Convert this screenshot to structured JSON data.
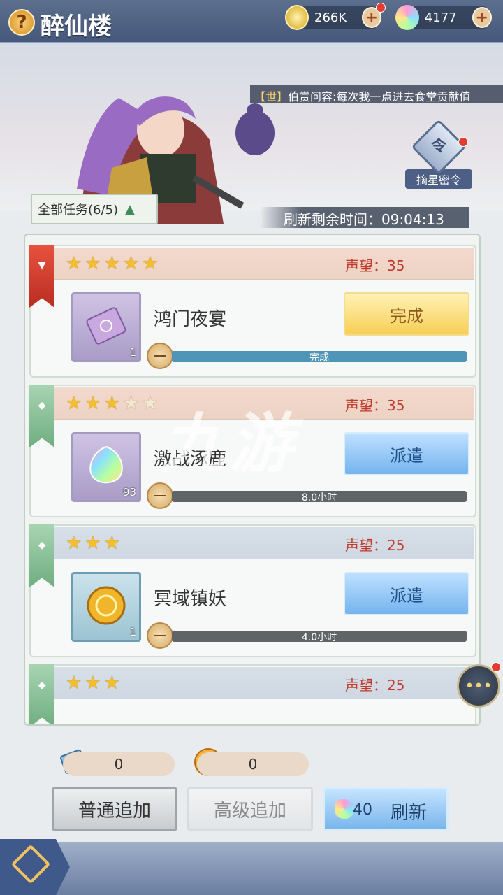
{
  "header": {
    "title": "醉仙楼",
    "help_icon": "?",
    "coins": "266K",
    "gems": "4177",
    "plus": "+"
  },
  "banner": {
    "ticker_tag": "【世】",
    "ticker_text": "伯赏问容:每次我一点进去食堂贡献值",
    "seal_glyph": "令",
    "seal_label": "摘星密令"
  },
  "filter": {
    "all_tasks": "全部任务(6/5)"
  },
  "refresh_timer": "刷新剩余时间：09:04:13",
  "tasks": [
    {
      "stars": 5,
      "max_stars": 5,
      "prestige": "声望：35",
      "name": "鸿门夜宴",
      "count": "1",
      "action": "完成",
      "progress_text": "完成",
      "progress": 1.0,
      "ribbon": "red"
    },
    {
      "stars": 3,
      "max_stars": 5,
      "prestige": "声望：35",
      "name": "激战涿鹿",
      "count": "93",
      "action": "派遣",
      "progress_text": "8.0小时",
      "progress": 0.0,
      "ribbon": "green"
    },
    {
      "stars": 3,
      "max_stars": 3,
      "prestige": "声望：25",
      "name": "冥域镇妖",
      "count": "1",
      "action": "派遣",
      "progress_text": "4.0小时",
      "progress": 0.0,
      "ribbon": "green"
    },
    {
      "stars": 3,
      "max_stars": 3,
      "prestige": "声望：25",
      "name": "",
      "count": "",
      "action": "",
      "progress_text": "",
      "progress": 0.0,
      "ribbon": "green"
    }
  ],
  "bottom": {
    "scroll_count": "0",
    "token_count": "0",
    "normal_add": "普通追加",
    "advanced_add": "高级追加",
    "refresh_cost": "40",
    "refresh": "刷新"
  },
  "watermark": "九游",
  "colors": {
    "header_bg": "#4f6283",
    "accent_gold": "#f7cf54",
    "accent_blue": "#74b4ee",
    "prestige_red": "#c0392b"
  }
}
